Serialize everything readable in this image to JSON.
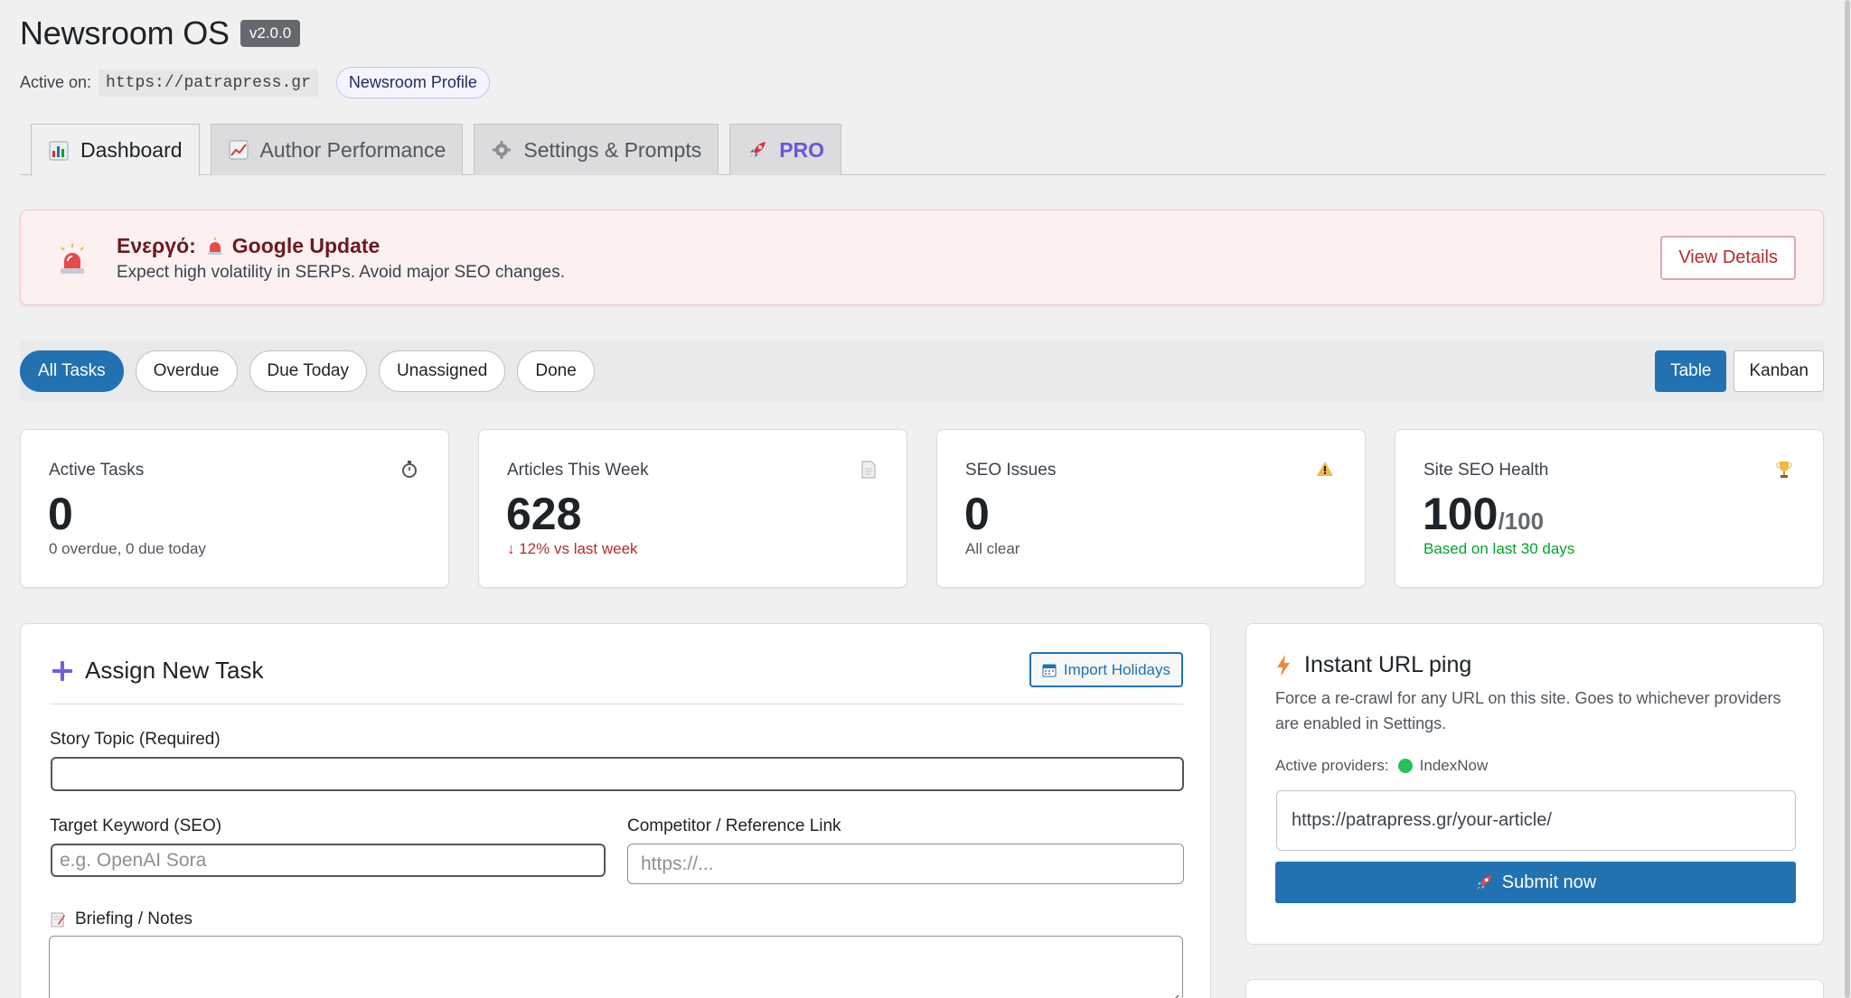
{
  "header": {
    "title": "Newsroom OS",
    "version": "v2.0.0",
    "active_label": "Active on:",
    "active_url": "https://patrapress.gr",
    "profile_label": "Newsroom Profile"
  },
  "tabs": [
    {
      "label": "Dashboard",
      "icon": "bar-chart-icon",
      "active": true
    },
    {
      "label": "Author Performance",
      "icon": "line-chart-icon",
      "active": false
    },
    {
      "label": "Settings & Prompts",
      "icon": "gear-icon",
      "active": false
    },
    {
      "label": "PRO",
      "icon": "rocket-icon",
      "active": false
    }
  ],
  "alert": {
    "prefix": "Ενεργό:",
    "name": "Google Update",
    "description": "Expect high volatility in SERPs. Avoid major SEO changes.",
    "button_label": "View Details",
    "icon": "siren-icon"
  },
  "filters": {
    "items": [
      "All Tasks",
      "Overdue",
      "Due Today",
      "Unassigned",
      "Done"
    ],
    "active": "All Tasks",
    "views": [
      "Table",
      "Kanban"
    ],
    "active_view": "Table"
  },
  "stats": [
    {
      "label": "Active Tasks",
      "value": "0",
      "unit": "",
      "sub": "0 overdue, 0 due today",
      "icon": "stopwatch-icon",
      "sub_color": "normal"
    },
    {
      "label": "Articles This Week",
      "value": "628",
      "unit": "",
      "sub": "↓ 12% vs last week",
      "icon": "document-icon",
      "sub_color": "red"
    },
    {
      "label": "SEO Issues",
      "value": "0",
      "unit": "",
      "sub": "All clear",
      "icon": "warning-icon",
      "sub_color": "normal"
    },
    {
      "label": "Site SEO Health",
      "value": "100",
      "unit": "/100",
      "sub": "Based on last 30 days",
      "icon": "trophy-icon",
      "sub_color": "green"
    }
  ],
  "assign": {
    "title": "Assign New Task",
    "import_label": "Import Holidays",
    "story_label": "Story Topic (Required)",
    "story_value": "",
    "keyword_label": "Target Keyword (SEO)",
    "keyword_placeholder": "e.g. OpenAI Sora",
    "competitor_label": "Competitor / Reference Link",
    "competitor_placeholder": "https://...",
    "notes_label": "Briefing / Notes"
  },
  "ping": {
    "title": "Instant URL ping",
    "description": "Force a re-crawl for any URL on this site. Goes to whichever providers are enabled in Settings.",
    "providers_label": "Active providers:",
    "provider_name": "IndexNow",
    "url_placeholder": "https://patrapress.gr/your-article/",
    "submit_label": "Submit now"
  },
  "colors": {
    "accent": "#2271b1",
    "alert_bg": "#fcf0f1",
    "pro": "#6b55d8",
    "danger": "#b32d2e",
    "success": "#00a32a"
  }
}
